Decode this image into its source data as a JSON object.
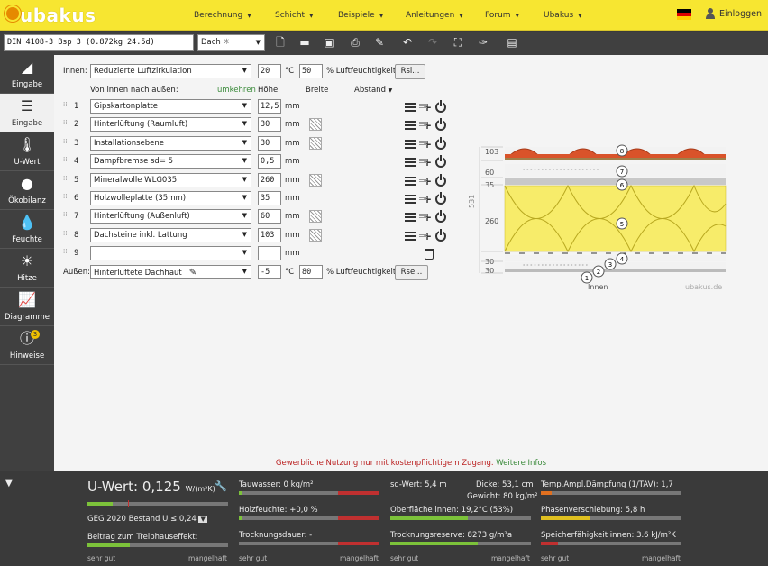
{
  "nav": {
    "logo": "ubakus",
    "menu": [
      {
        "label": "Berechnung"
      },
      {
        "label": "Schicht"
      },
      {
        "label": "Beispiele"
      },
      {
        "label": "Anleitungen"
      },
      {
        "label": "Forum"
      },
      {
        "label": "Ubakus"
      }
    ],
    "login": "Einloggen"
  },
  "toolbar": {
    "project_name": "DIN 4108-3 Bsp 3 (0.872kg 24.5d)",
    "element_type": "Dach"
  },
  "sidebar": {
    "items": [
      {
        "label": "Eingabe",
        "icon": "roof-pencil-icon"
      },
      {
        "label": "Eingabe",
        "icon": "layers-icon"
      },
      {
        "label": "U-Wert",
        "icon": "thermometer-icon"
      },
      {
        "label": "Ökobilanz",
        "icon": "globe-icon"
      },
      {
        "label": "Feuchte",
        "icon": "droplet-icon"
      },
      {
        "label": "Hitze",
        "icon": "sun-icon"
      },
      {
        "label": "Diagramme",
        "icon": "chart-icon"
      },
      {
        "label": "Hinweise",
        "icon": "alert-icon",
        "badge": "3"
      }
    ]
  },
  "inside": {
    "label": "Innen:",
    "climate": "Reduzierte Luftzirkulation",
    "temp": "20",
    "temp_unit": "°C",
    "humidity": "50",
    "humidity_unit": "% Luftfeuchtigkeit",
    "rsi_button": "Rsi..."
  },
  "headers": {
    "direction": "Von innen nach außen:",
    "reverse": "umkehren",
    "height": "Höhe",
    "width": "Breite",
    "spacing": "Abstand"
  },
  "layers": [
    {
      "num": "1",
      "material": "Gipskartonplatte",
      "thickness": "12,5",
      "unit": "mm",
      "hatch": false
    },
    {
      "num": "2",
      "material": "Hinterlüftung (Raumluft)",
      "thickness": "30",
      "unit": "mm",
      "hatch": true
    },
    {
      "num": "3",
      "material": "Installationsebene",
      "thickness": "30",
      "unit": "mm",
      "hatch": true
    },
    {
      "num": "4",
      "material": "Dampfbremse sd= 5",
      "thickness": "0,5",
      "unit": "mm",
      "hatch": false
    },
    {
      "num": "5",
      "material": "Mineralwolle WLG035",
      "thickness": "260",
      "unit": "mm",
      "hatch": true
    },
    {
      "num": "6",
      "material": "Holzwolleplatte (35mm)",
      "thickness": "35",
      "unit": "mm",
      "hatch": false
    },
    {
      "num": "7",
      "material": "Hinterlüftung (Außenluft)",
      "thickness": "60",
      "unit": "mm",
      "hatch": true
    },
    {
      "num": "8",
      "material": "Dachsteine inkl. Lattung",
      "thickness": "103",
      "unit": "mm",
      "hatch": true
    },
    {
      "num": "9",
      "material": "",
      "thickness": "",
      "unit": "mm",
      "hatch": false
    }
  ],
  "outside": {
    "label": "Außen:",
    "climate": "Hinterlüftete Dachhaut",
    "temp": "-5",
    "temp_unit": "°C",
    "humidity": "80",
    "humidity_unit": "% Luftfeuchtigkeit",
    "rse_button": "Rse..."
  },
  "diagram": {
    "dims": [
      "103",
      "60",
      "35",
      "260",
      "30",
      "30"
    ],
    "total": "531",
    "markers": [
      "1",
      "2",
      "3",
      "4",
      "5",
      "6",
      "7",
      "8"
    ],
    "inside_label": "Innen",
    "watermark": "ubakus.de"
  },
  "notice": {
    "text": "Gewerbliche Nutzung nur mit kostenpflichtigem Zugang.",
    "link": "Weitere Infos"
  },
  "results": {
    "uvalue_label": "U-Wert:",
    "uvalue": "0,125",
    "uvalue_unit": "W/(m²K)",
    "uvalue_level": 0.18,
    "geg": "GEG 2020 Bestand U ≤ 0,24",
    "greenhouse": "Beitrag zum Treibhauseffekt:",
    "greenhouse_level": 0.3,
    "scale_good": "sehr gut",
    "scale_bad": "mangelhaft",
    "tauwasser": "Tauwasser: 0 kg/m²",
    "tauwasser_level": 0.02,
    "holzfeuchte": "Holzfeuchte: +0,0 %",
    "holzfeuchte_level": 0.02,
    "trocknungsdauer": "Trocknungsdauer: -",
    "sd": "sd-Wert: 5,4 m",
    "dicke": "Dicke: 53,1 cm",
    "gewicht": "Gewicht: 80 kg/m²",
    "oberflaeche": "Oberfläche innen: 19,2°C (53%)",
    "oberflaeche_level": 0.55,
    "trocknungsreserve": "Trocknungsreserve: 8273 g/m²a",
    "trocknungsreserve_level": 0.62,
    "tav": "Temp.Ampl.Dämpfung (1/TAV): 1,7",
    "tav_level": 0.08,
    "phase": "Phasenverschiebung: 5,8 h",
    "phase_level": 0.35,
    "speicher": "Speicherfähigkeit innen: 3.6 kJ/m²K",
    "speicher_level": 0.12,
    "colors": {
      "good": "#7cc23a",
      "mid": "#e0c020",
      "bad": "#c03030",
      "warn": "#e07020"
    }
  }
}
